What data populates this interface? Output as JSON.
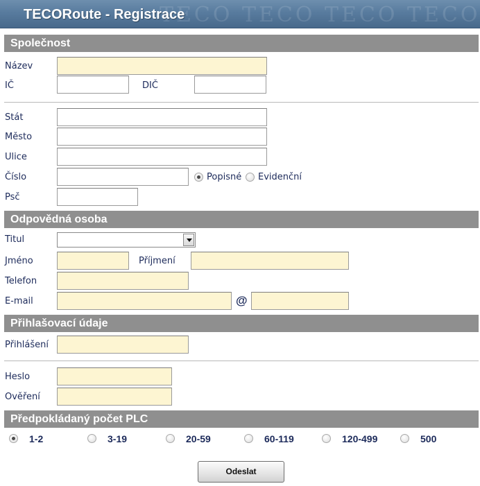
{
  "app": {
    "title": "TECORoute - Registrace",
    "watermark": "TECO TECO TECO TECO"
  },
  "company": {
    "header": "Společnost",
    "name_label": "Název",
    "ic_label": "IČ",
    "dic_label": "DIČ",
    "state_label": "Stát",
    "city_label": "Město",
    "street_label": "Ulice",
    "number_label": "Číslo",
    "number_type_options": [
      "Popisné",
      "Evidenční"
    ],
    "number_type_selected": "Popisné",
    "zip_label": "Psč",
    "values": {
      "name": "",
      "ic": "",
      "dic": "",
      "state": "",
      "city": "",
      "street": "",
      "number": "",
      "zip": ""
    }
  },
  "person": {
    "header": "Odpovědná osoba",
    "title_label": "Titul",
    "title_value": "",
    "first_name_label": "Jméno",
    "last_name_label": "Příjmení",
    "phone_label": "Telefon",
    "email_label": "E-mail",
    "at_symbol": "@",
    "values": {
      "first_name": "",
      "last_name": "",
      "phone": "",
      "email_user": "",
      "email_domain": ""
    }
  },
  "login": {
    "header": "Přihlašovací údaje",
    "login_label": "Přihlášení",
    "password_label": "Heslo",
    "verify_label": "Ověření",
    "values": {
      "login": "",
      "password": "",
      "verify": ""
    }
  },
  "plc": {
    "header": "Předpokládaný počet PLC",
    "options": [
      "1-2",
      "3-19",
      "20-59",
      "60-119",
      "120-499",
      "500"
    ],
    "selected": "1-2"
  },
  "submit": {
    "label": "Odeslat"
  },
  "colors": {
    "required_field_bg": "#fdf5d2",
    "section_header_bg": "#8f8f8f",
    "label_text": "#1c2a5a",
    "title_bar": "#587b9e"
  }
}
